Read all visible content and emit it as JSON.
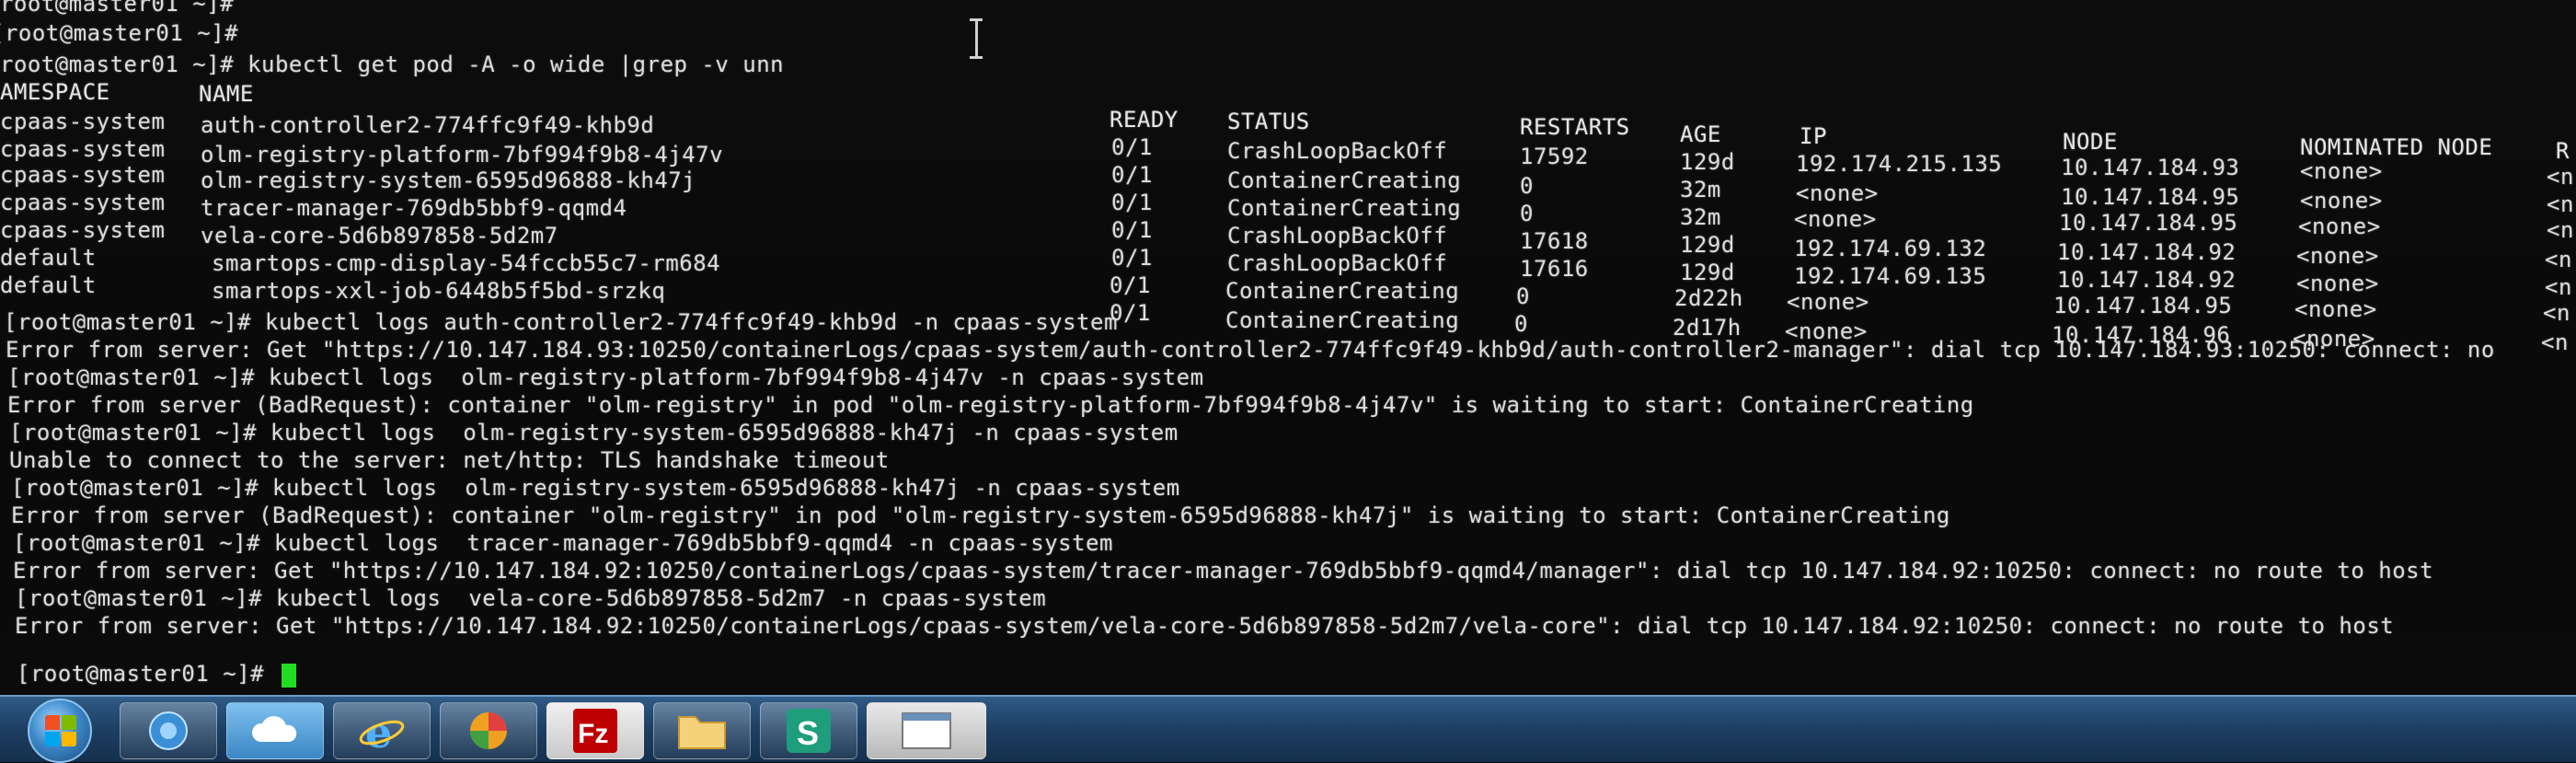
{
  "terminal": {
    "lines": [
      "root@master01 ~]#",
      "[root@master01 ~]#",
      "root@master01 ~]# kubectl get pod -A -o wide |grep -v unn",
      "[root@master01 ~]# kubectl logs auth-controller2-774ffc9f49-khb9d -n cpaas-system",
      "Error from server: Get \"https://10.147.184.93:10250/containerLogs/cpaas-system/auth-controller2-774ffc9f49-khb9d/auth-controller2-manager\": dial tcp 10.147.184.93:10250: connect: no",
      "[root@master01 ~]# kubectl logs  olm-registry-platform-7bf994f9b8-4j47v -n cpaas-system",
      "Error from server (BadRequest): container \"olm-registry\" in pod \"olm-registry-platform-7bf994f9b8-4j47v\" is waiting to start: ContainerCreating",
      "[root@master01 ~]# kubectl logs  olm-registry-system-6595d96888-kh47j -n cpaas-system",
      "Unable to connect to the server: net/http: TLS handshake timeout",
      "[root@master01 ~]# kubectl logs  olm-registry-system-6595d96888-kh47j -n cpaas-system",
      "Error from server (BadRequest): container \"olm-registry\" in pod \"olm-registry-system-6595d96888-kh47j\" is waiting to start: ContainerCreating",
      "[root@master01 ~]# kubectl logs  tracer-manager-769db5bbf9-qqmd4 -n cpaas-system",
      "Error from server: Get \"https://10.147.184.92:10250/containerLogs/cpaas-system/tracer-manager-769db5bbf9-qqmd4/manager\": dial tcp 10.147.184.92:10250: connect: no route to host",
      "[root@master01 ~]# kubectl logs  vela-core-5d6b897858-5d2m7 -n cpaas-system",
      "Error from server: Get \"https://10.147.184.92:10250/containerLogs/cpaas-system/vela-core-5d6b897858-5d2m7/vela-core\": dial tcp 10.147.184.92:10250: connect: no route to host",
      "[root@master01 ~]#"
    ],
    "table": {
      "headers": {
        "namespace": "AMESPACE",
        "name": "NAME",
        "ready": "READY",
        "status": "STATUS",
        "restarts": "RESTARTS",
        "age": "AGE",
        "ip": "IP",
        "node": "NODE",
        "nominated": "NOMINATED NODE",
        "readiness": "R"
      },
      "rows": [
        {
          "namespace": "cpaas-system",
          "name": "auth-controller2-774ffc9f49-khb9d",
          "ready": "0/1",
          "status": "CrashLoopBackOff",
          "restarts": "17592",
          "age": "129d",
          "ip": "192.174.215.135",
          "node": "10.147.184.93",
          "nominated": "<none>",
          "readiness": "<n"
        },
        {
          "namespace": "cpaas-system",
          "name": "olm-registry-platform-7bf994f9b8-4j47v",
          "ready": "0/1",
          "status": "ContainerCreating",
          "restarts": "0",
          "age": "32m",
          "ip": "<none>",
          "node": "10.147.184.95",
          "nominated": "<none>",
          "readiness": "<n"
        },
        {
          "namespace": "cpaas-system",
          "name": "olm-registry-system-6595d96888-kh47j",
          "ready": "0/1",
          "status": "ContainerCreating",
          "restarts": "0",
          "age": "32m",
          "ip": "<none>",
          "node": "10.147.184.95",
          "nominated": "<none>",
          "readiness": "<n"
        },
        {
          "namespace": "cpaas-system",
          "name": "tracer-manager-769db5bbf9-qqmd4",
          "ready": "0/1",
          "status": "CrashLoopBackOff",
          "restarts": "17618",
          "age": "129d",
          "ip": "192.174.69.132",
          "node": "10.147.184.92",
          "nominated": "<none>",
          "readiness": "<n"
        },
        {
          "namespace": "cpaas-system",
          "name": "vela-core-5d6b897858-5d2m7",
          "ready": "0/1",
          "status": "CrashLoopBackOff",
          "restarts": "17616",
          "age": "129d",
          "ip": "192.174.69.135",
          "node": "10.147.184.92",
          "nominated": "<none>",
          "readiness": "<n"
        },
        {
          "namespace": "default",
          "name": "smartops-cmp-display-54fccb55c7-rm684",
          "ready": "0/1",
          "status": "ContainerCreating",
          "restarts": "0",
          "age": "2d22h",
          "ip": "<none>",
          "node": "10.147.184.95",
          "nominated": "<none>",
          "readiness": "<n"
        },
        {
          "namespace": "default",
          "name": "smartops-xxl-job-6448b5f5bd-srzkq",
          "ready": "0/1",
          "status": "ContainerCreating",
          "restarts": "0",
          "age": "2d17h",
          "ip": "<none>",
          "node": "10.147.184.96",
          "nominated": "<none>",
          "readiness": "<n"
        }
      ]
    },
    "cursor_color": "#22dd22"
  },
  "taskbar": {
    "items": [
      {
        "icon": "start-orb-icon"
      },
      {
        "icon": "network-icon"
      },
      {
        "icon": "cloud-icon"
      },
      {
        "icon": "internet-explorer-icon"
      },
      {
        "icon": "media-icon"
      },
      {
        "icon": "filezilla-icon",
        "label": "Fz"
      },
      {
        "icon": "folder-icon"
      },
      {
        "icon": "terminal-app-icon",
        "label": "S"
      },
      {
        "icon": "window-icon"
      }
    ]
  }
}
